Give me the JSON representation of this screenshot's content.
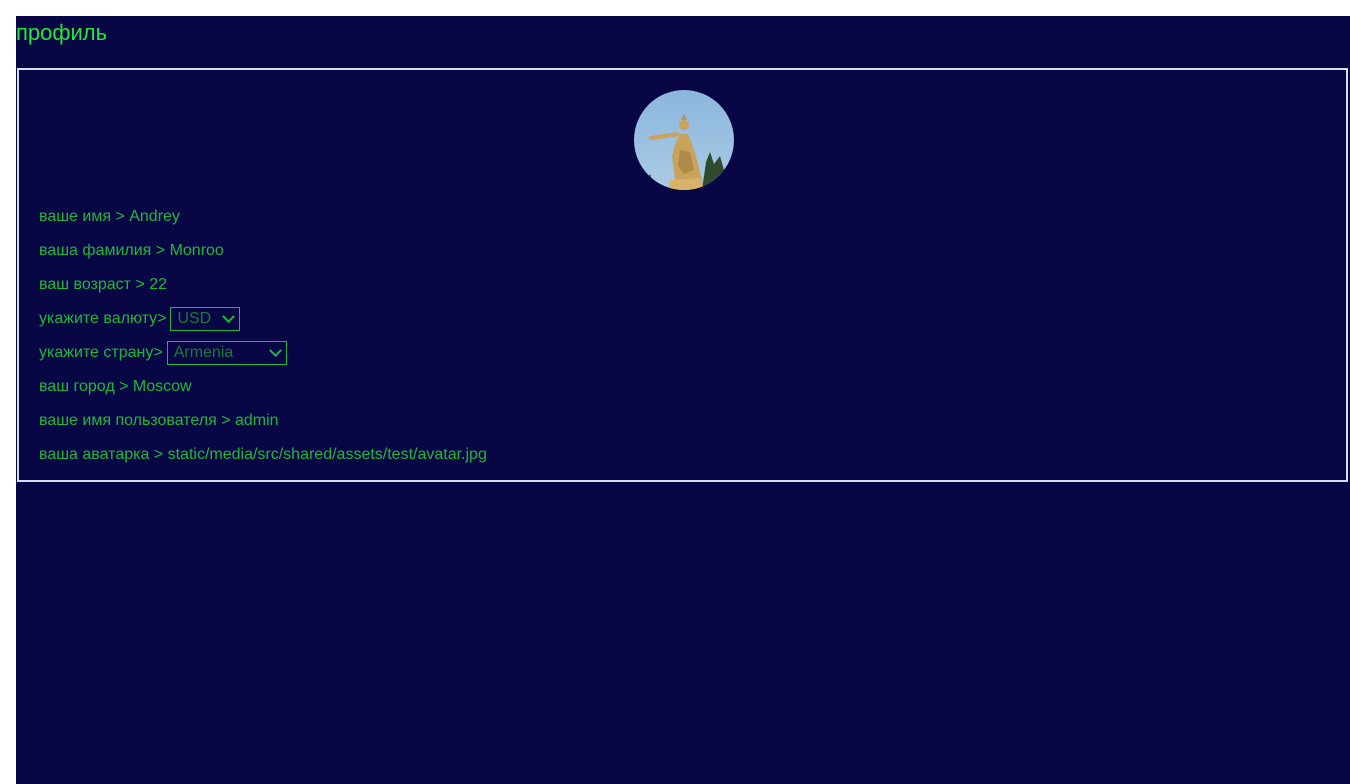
{
  "page": {
    "title": "профиль"
  },
  "colors": {
    "background": "#080645",
    "title": "#1ee83a",
    "text": "#1fb83d",
    "card_border": "#d9dde6"
  },
  "avatar": {
    "icon": "statue-photo"
  },
  "profile": {
    "first_name": {
      "label": "ваше имя",
      "sep": " > ",
      "value": "Andrey"
    },
    "last_name": {
      "label": "ваша фамилия",
      "sep": " > ",
      "value": "Monroo"
    },
    "age": {
      "label": "ваш возраст",
      "sep": " > ",
      "value": "22"
    },
    "currency": {
      "label": "укажите валюту>",
      "selected": "USD"
    },
    "country": {
      "label": "укажите страну>",
      "selected": "Armenia"
    },
    "city": {
      "label": "ваш город",
      "sep": " > ",
      "value": "Moscow"
    },
    "username": {
      "label": "ваше имя пользователя",
      "sep": " > ",
      "value": "admin"
    },
    "avatar_path": {
      "label": "ваша аватарка",
      "sep": " > ",
      "value": "static/media/src/shared/assets/test/avatar.jpg"
    }
  }
}
